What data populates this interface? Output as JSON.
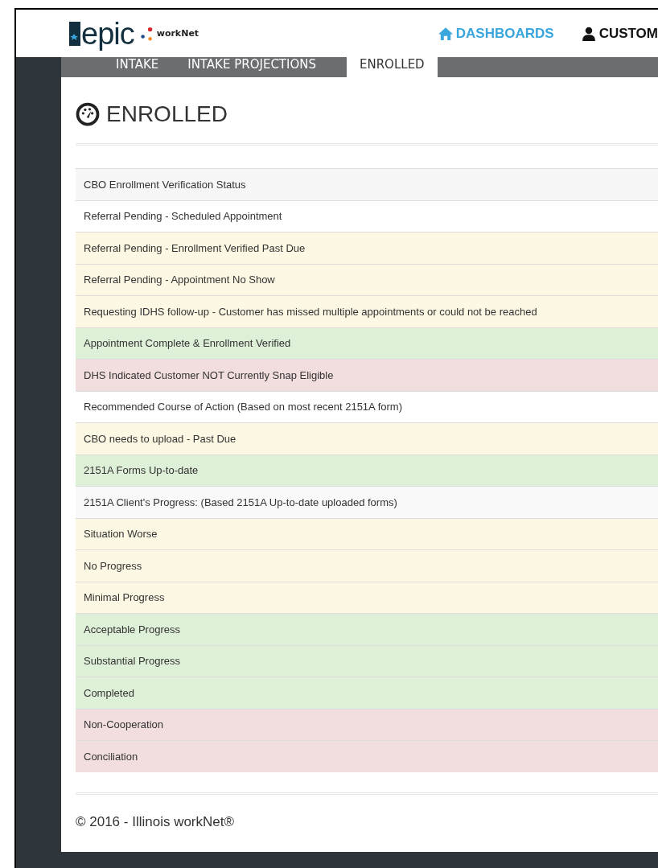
{
  "header": {
    "logo": {
      "brand": "epic",
      "name": "workNet"
    },
    "nav": [
      {
        "label": "DASHBOARDS",
        "selected": true
      },
      {
        "label": "CUSTOM",
        "selected": false
      }
    ]
  },
  "tabs": [
    {
      "label": "INTAKE",
      "selected": false
    },
    {
      "label": "INTAKE PROJECTIONS",
      "selected": false
    },
    {
      "label": "ENROLLED",
      "selected": true
    }
  ],
  "page_title": "ENROLLED",
  "rows": [
    {
      "text": "CBO Enrollment Verification Status",
      "color": "#f7f7f7"
    },
    {
      "text": "Referral Pending - Scheduled Appointment",
      "color": "#ffffff"
    },
    {
      "text": "Referral Pending - Enrollment Verified Past Due",
      "color": "#fcf8e3"
    },
    {
      "text": "Referral Pending - Appointment No Show",
      "color": "#fcf8e3"
    },
    {
      "text": "Requesting IDHS follow-up - Customer has missed multiple appointments or could not be reached",
      "color": "#fcf8e3"
    },
    {
      "text": "Appointment Complete & Enrollment Verified",
      "color": "#dff0d8"
    },
    {
      "text": "DHS Indicated Customer NOT Currently Snap Eligible",
      "color": "#f2dede"
    },
    {
      "text": "Recommended Course of Action (Based on most recent 2151A form)",
      "color": "#ffffff"
    },
    {
      "text": "CBO needs to upload - Past Due",
      "color": "#fcf8e3"
    },
    {
      "text": "2151A Forms Up-to-date",
      "color": "#dff0d8"
    },
    {
      "text": "2151A Client's Progress: (Based 2151A Up-to-date uploaded forms)",
      "color": "#f9f9f9"
    },
    {
      "text": "Situation Worse",
      "color": "#fcf8e3"
    },
    {
      "text": "No Progress",
      "color": "#fcf8e3"
    },
    {
      "text": "Minimal Progress",
      "color": "#fcf8e3"
    },
    {
      "text": "Acceptable Progress",
      "color": "#dff0d8"
    },
    {
      "text": "Substantial Progress",
      "color": "#dff0d8"
    },
    {
      "text": "Completed",
      "color": "#dff0d8"
    },
    {
      "text": "Non-Cooperation",
      "color": "#f2dede"
    },
    {
      "text": "Conciliation",
      "color": "#f2dede"
    }
  ],
  "footer": "© 2016 - Illinois workNet®"
}
